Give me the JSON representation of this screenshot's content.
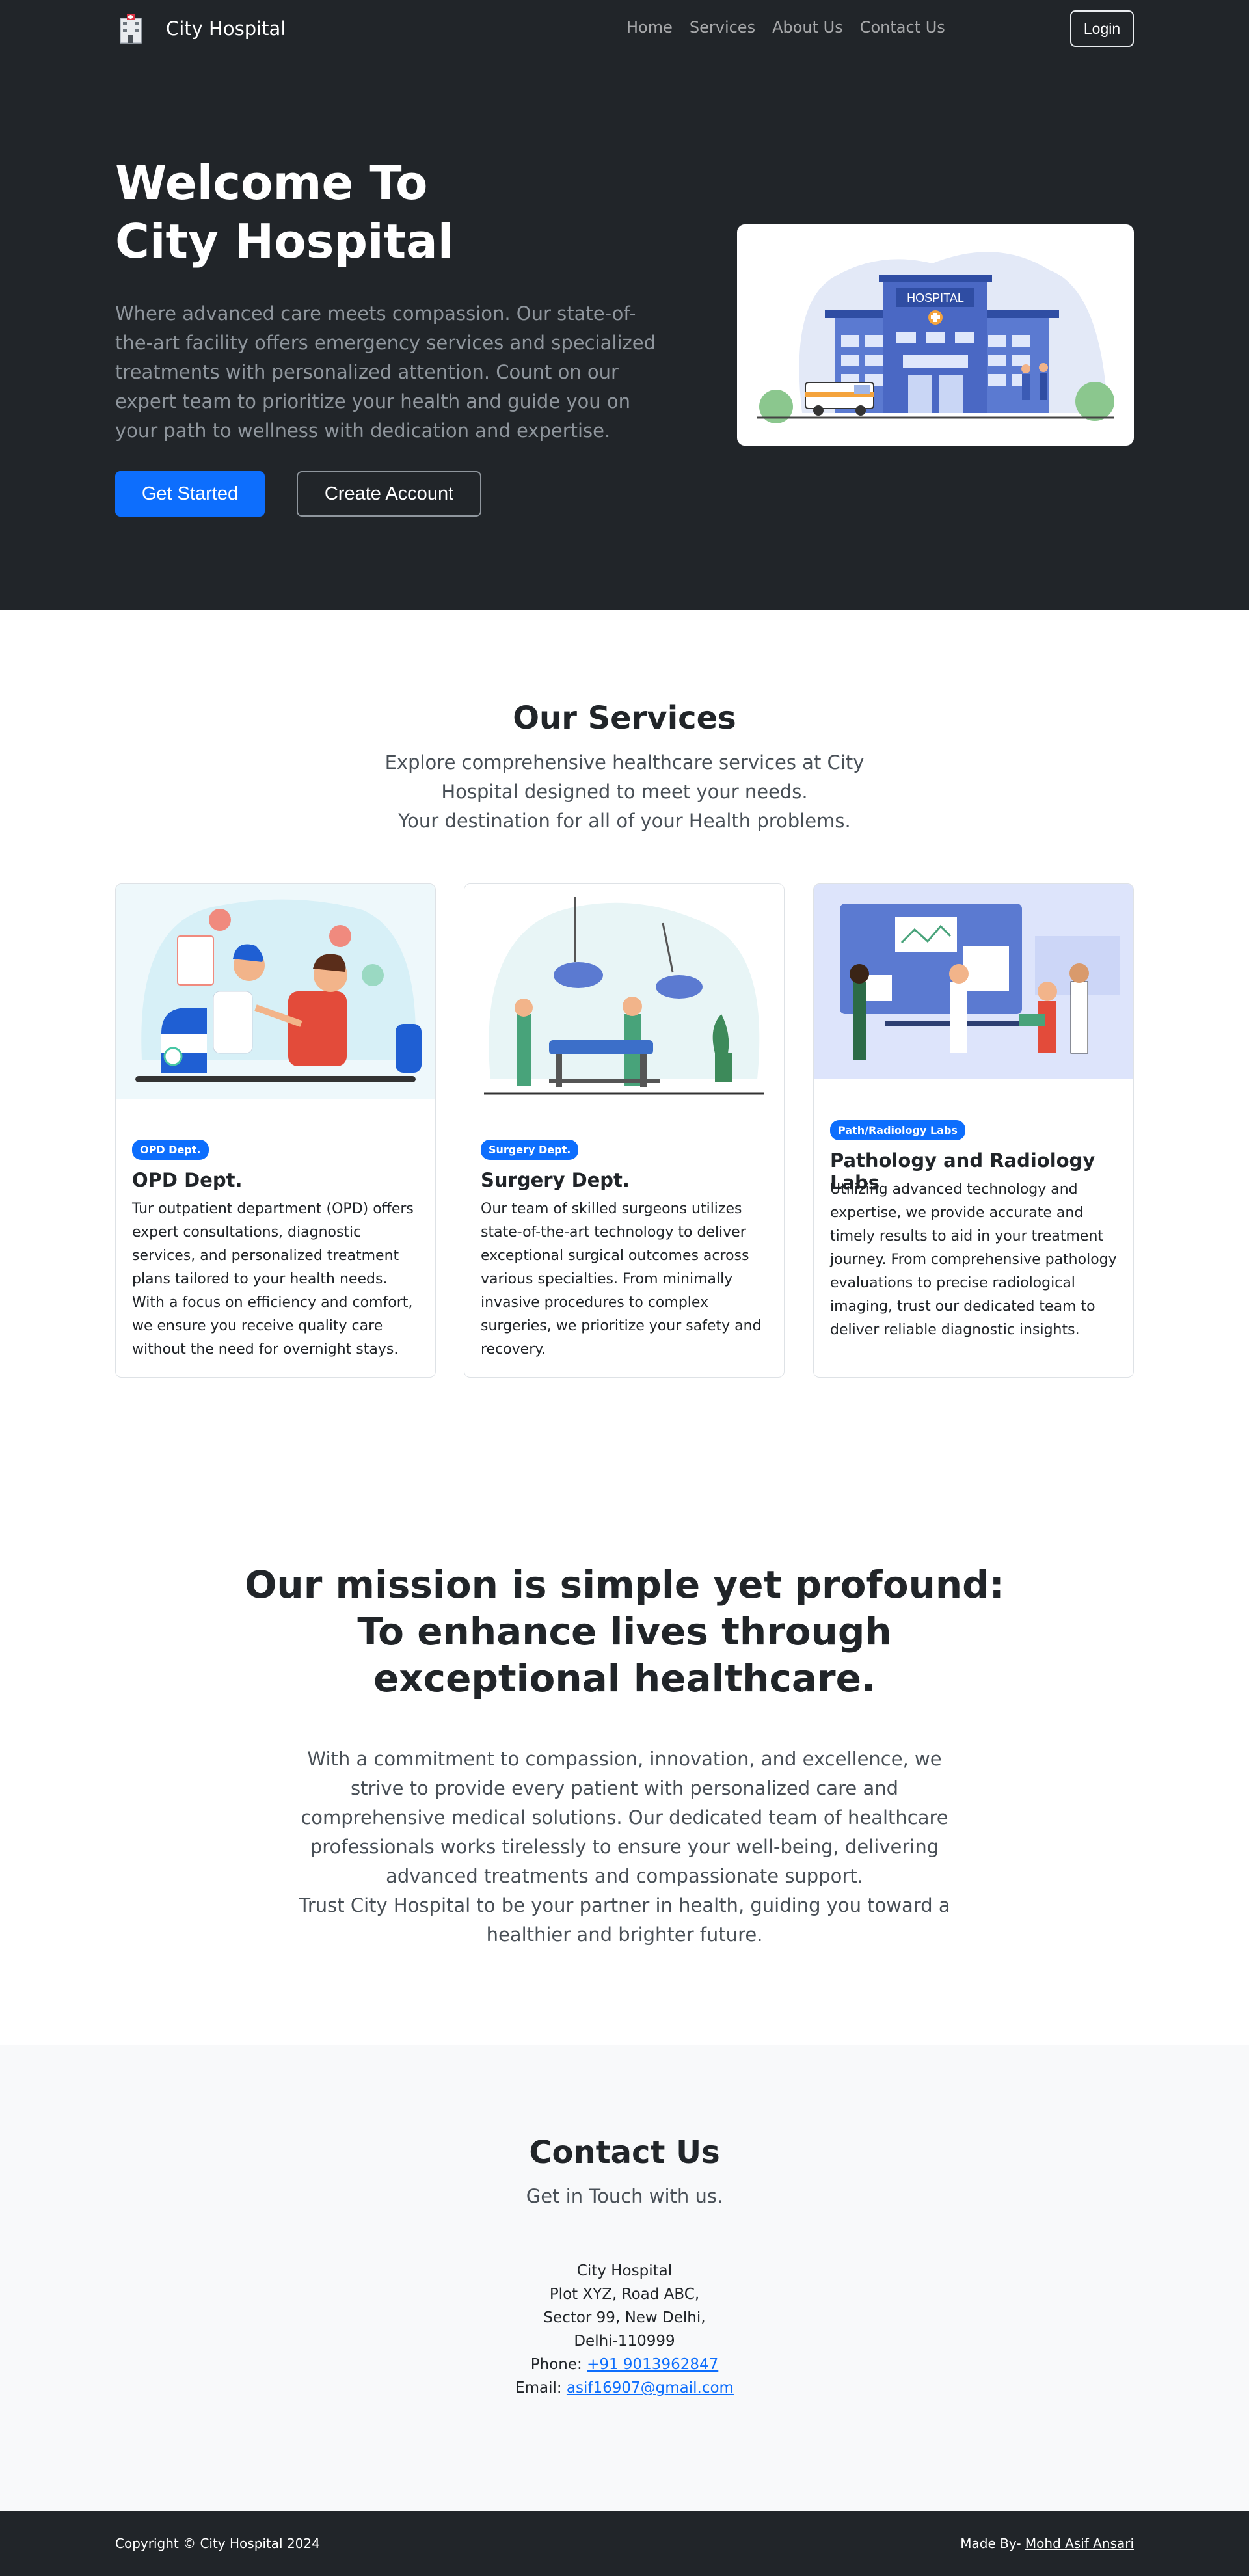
{
  "nav": {
    "brand": "City Hospital",
    "links": [
      "Home",
      "Services",
      "About Us",
      "Contact Us"
    ],
    "login": "Login"
  },
  "hero": {
    "title_line1": "Welcome To",
    "title_line2": "City Hospital",
    "lead": "Where advanced care meets compassion. Our state-of-the-art facility offers emergency services and specialized treatments with personalized attention. Count on our expert team to prioritize your health and guide you on your path to wellness with dedication and expertise.",
    "primary_button": "Get Started",
    "secondary_button": "Create Account",
    "image_sign": "HOSPITAL"
  },
  "services": {
    "heading": "Our Services",
    "sub_line1": "Explore comprehensive healthcare services at City Hospital designed to meet your needs.",
    "sub_line2": "Your destination for all of your Health problems.",
    "cards": [
      {
        "badge": "OPD Dept.",
        "title": "OPD Dept.",
        "text": "Tur outpatient department (OPD) offers expert consultations, diagnostic services, and personalized treatment plans tailored to your health needs. With a focus on efficiency and comfort, we ensure you receive quality care without the need for overnight stays."
      },
      {
        "badge": "Surgery Dept.",
        "title": "Surgery Dept.",
        "text": "Our team of skilled surgeons utilizes state-of-the-art technology to deliver exceptional surgical outcomes across various specialties. From minimally invasive procedures to complex surgeries, we prioritize your safety and recovery."
      },
      {
        "badge": "Path/Radiology Labs",
        "title": "Pathology and Radiology Labs",
        "text": "Utilizing advanced technology and expertise, we provide accurate and timely results to aid in your treatment journey. From comprehensive pathology evaluations to precise radiological imaging, trust our dedicated team to deliver reliable diagnostic insights."
      }
    ]
  },
  "mission": {
    "title_line1": "Our mission is simple yet profound:",
    "title_line2": "To enhance lives through exceptional healthcare.",
    "text1": "With a commitment to compassion, innovation, and excellence, we strive to provide every patient with personalized care and comprehensive medical solutions. Our dedicated team of healthcare professionals works tirelessly to ensure your well-being, delivering advanced treatments and compassionate support.",
    "text2": "Trust City Hospital to be your partner in health, guiding you toward a healthier and brighter future."
  },
  "contact": {
    "heading": "Contact Us",
    "sub": "Get in Touch with us.",
    "name": "City Hospital",
    "addr1": "Plot XYZ, Road ABC,",
    "addr2": "Sector 99, New Delhi,",
    "addr3": "Delhi-110999",
    "phone_label": "Phone:",
    "phone": "+91 9013962847",
    "email_label": "Email:",
    "email": "asif16907@gmail.com"
  },
  "footer": {
    "copyright": "Copyright © City Hospital 2024",
    "made_by_label": "Made By-",
    "author": "Mohd Asif Ansari"
  },
  "colors": {
    "dark": "#212529",
    "primary": "#0d6efd",
    "muted": "#8f969d",
    "light_bg": "#f8f9fa"
  }
}
